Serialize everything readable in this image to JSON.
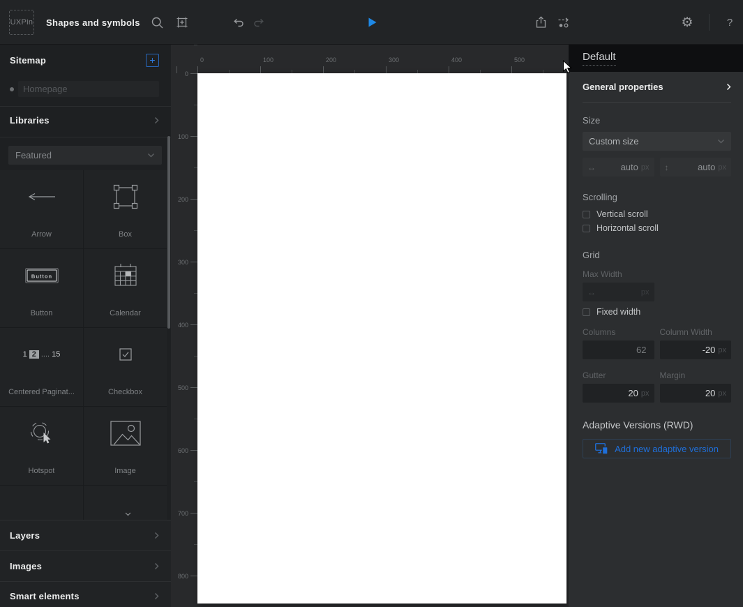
{
  "topbar": {
    "logo": "UXPin",
    "title": "Shapes and symbols"
  },
  "sidebar": {
    "sitemap": {
      "title": "Sitemap",
      "add": "+",
      "page": "Homepage"
    },
    "libraries": {
      "title": "Libraries",
      "dropdown": "Featured",
      "items": [
        {
          "label": "Arrow"
        },
        {
          "label": "Box"
        },
        {
          "label": "Button"
        },
        {
          "label": "Calendar"
        },
        {
          "label": "Centered Paginat..."
        },
        {
          "label": "Checkbox"
        },
        {
          "label": "Hotspot"
        },
        {
          "label": "Image"
        }
      ],
      "button_icon_text": "Button",
      "pagination_icon": {
        "first": "1",
        "current": "2",
        "ellipsis": "....",
        "last": "15"
      }
    },
    "sections": [
      {
        "label": "Layers"
      },
      {
        "label": "Images"
      },
      {
        "label": "Smart elements"
      }
    ]
  },
  "canvas": {
    "rulers": {
      "top": [
        "0",
        "100",
        "200",
        "300",
        "400",
        "500"
      ],
      "left": [
        "0",
        "100",
        "200",
        "300",
        "400",
        "500",
        "600",
        "700",
        "800"
      ]
    }
  },
  "panel": {
    "title": "Default",
    "general_properties": "General properties",
    "size": {
      "label": "Size",
      "preset": "Custom size",
      "width_value": "auto",
      "height_value": "auto",
      "unit": "px"
    },
    "scrolling": {
      "label": "Scrolling",
      "vertical": "Vertical scroll",
      "horizontal": "Horizontal scroll"
    },
    "grid": {
      "label": "Grid",
      "max_width_label": "Max Width",
      "fixed_width": "Fixed width",
      "columns_label": "Columns",
      "columns_value": "62",
      "column_width_label": "Column Width",
      "column_width_value": "-20",
      "gutter_label": "Gutter",
      "gutter_value": "20",
      "margin_label": "Margin",
      "margin_value": "20",
      "unit": "px"
    },
    "adaptive": {
      "label": "Adaptive Versions (RWD)",
      "button": "Add new adaptive version"
    }
  },
  "colors": {
    "accent_blue": "#1f6fd9",
    "play_blue": "#1e88e5",
    "canvas_white": "#ffffff"
  }
}
